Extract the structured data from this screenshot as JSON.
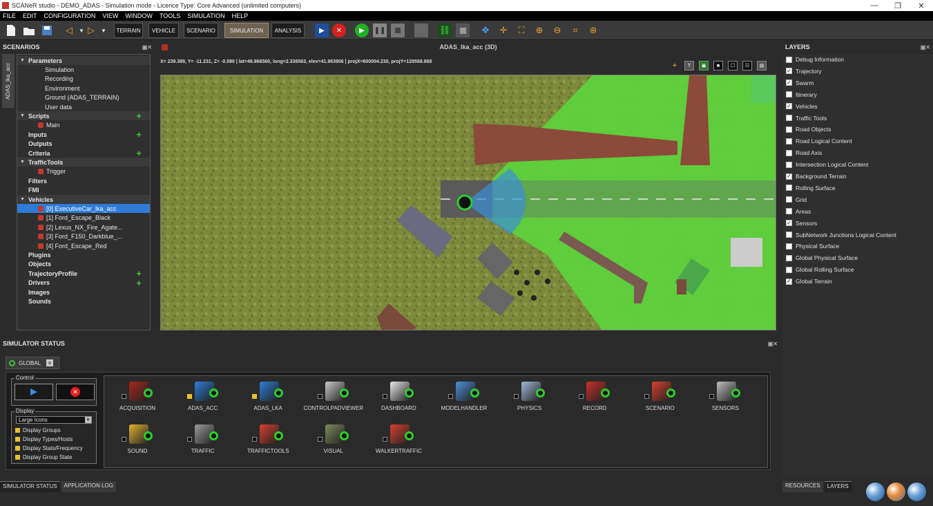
{
  "window": {
    "title": "SCANeR studio - DEMO_ADAS - Simulation mode - Licence Type: Core Advanced (unlimited computers)",
    "controls": [
      "—",
      "❐",
      "✕"
    ]
  },
  "menu": [
    "FILE",
    "EDIT",
    "CONFIGURATION",
    "VIEW",
    "WINDOW",
    "TOOLS",
    "SIMULATION",
    "HELP"
  ],
  "toolbar": {
    "modes": [
      "TERRAIN",
      "VEHICLE",
      "SCENARIO",
      "SIMULATION",
      "ANALYSIS"
    ],
    "active_mode": "SIMULATION"
  },
  "scenarios": {
    "title": "SCENARIOS",
    "vtab": "ADAS_lka_acc",
    "tree": [
      {
        "label": "Parameters",
        "kind": "cat",
        "open": true
      },
      {
        "label": "Simulation",
        "kind": "leaf"
      },
      {
        "label": "Recording",
        "kind": "leaf"
      },
      {
        "label": "Environment",
        "kind": "leaf"
      },
      {
        "label": "Ground (ADAS_TERRAIN)",
        "kind": "leaf"
      },
      {
        "label": "User data",
        "kind": "leaf"
      },
      {
        "label": "Scripts",
        "kind": "cat",
        "open": true,
        "plus": true
      },
      {
        "label": "Main",
        "kind": "leaf2"
      },
      {
        "label": "Inputs",
        "kind": "cat2",
        "plus": true
      },
      {
        "label": "Outputs",
        "kind": "cat2"
      },
      {
        "label": "Criteria",
        "kind": "cat2",
        "plus": true
      },
      {
        "label": "TrafficTools",
        "kind": "cat",
        "open": true
      },
      {
        "label": "Trigger",
        "kind": "leaf2"
      },
      {
        "label": "Filters",
        "kind": "cat2"
      },
      {
        "label": "FMI",
        "kind": "cat2"
      },
      {
        "label": "Vehicles",
        "kind": "cat",
        "open": true
      },
      {
        "label": "[0] ExecutiveCar_lka_acc",
        "kind": "sel"
      },
      {
        "label": "[1] Ford_Escape_Black",
        "kind": "leaf2"
      },
      {
        "label": "[2] Lexus_NX_Fire_Agate...",
        "kind": "leaf2"
      },
      {
        "label": "[3] Ford_F150_Darkblue_...",
        "kind": "leaf2"
      },
      {
        "label": "[4] Ford_Escape_Red",
        "kind": "leaf2"
      },
      {
        "label": "Plugins",
        "kind": "cat2"
      },
      {
        "label": "Objects",
        "kind": "cat2"
      },
      {
        "label": "TrajectoryProfile",
        "kind": "cat2",
        "plus": true
      },
      {
        "label": "Drivers",
        "kind": "cat2",
        "plus": true
      },
      {
        "label": "Images",
        "kind": "cat2"
      },
      {
        "label": "Sounds",
        "kind": "cat2"
      }
    ]
  },
  "viewport": {
    "title": "ADAS_lka_acc (3D)",
    "coords": "X= 239.389, Y= -11.231, Z= -0.090 | lat=48.866560, long=2.336563, elev=41.963906 | projX=600004.230, projY=129568.868",
    "icons": [
      "⌖",
      "T",
      "▣",
      "■",
      "☐",
      "☷",
      "▤"
    ]
  },
  "layers": {
    "title": "LAYERS",
    "items": [
      {
        "label": "Debug Information",
        "checked": false
      },
      {
        "label": "Trajectory",
        "checked": true
      },
      {
        "label": "Swarm",
        "checked": true
      },
      {
        "label": "Itinerary",
        "checked": false
      },
      {
        "label": "Vehicles",
        "checked": true
      },
      {
        "label": "Traffic Tools",
        "checked": false
      },
      {
        "label": "Road Objects",
        "checked": false
      },
      {
        "label": "Road Logical Content",
        "checked": false
      },
      {
        "label": "Road Axis",
        "checked": false
      },
      {
        "label": "Intersection Logical Content",
        "checked": false
      },
      {
        "label": "Background Terrain",
        "checked": true
      },
      {
        "label": "Rolling Surface",
        "checked": false
      },
      {
        "label": "Grid",
        "checked": false
      },
      {
        "label": "Areas",
        "checked": false
      },
      {
        "label": "Sensors",
        "checked": true
      },
      {
        "label": "SubNetwork Junctions Logical Content",
        "checked": false
      },
      {
        "label": "Physical Surface",
        "checked": false
      },
      {
        "label": "Global Physical Surface",
        "checked": false
      },
      {
        "label": "Global Rolling Surface",
        "checked": false
      },
      {
        "label": "Global Terrain",
        "checked": true
      }
    ]
  },
  "sim": {
    "title": "SIMULATOR STATUS",
    "tab": "GLOBAL",
    "control_label": "Control",
    "display_label": "Display",
    "display_select": "Large Icons",
    "display_options": [
      "Display Groups",
      "Display Types/Hosts",
      "Display Stats/Frequency",
      "Display Group State"
    ],
    "modules": [
      {
        "label": "ACQUISITION",
        "checked": false,
        "color": "#a8261c"
      },
      {
        "label": "ADAS_ACC",
        "checked": true,
        "color": "#2f7cd6"
      },
      {
        "label": "ADAS_LKA",
        "checked": true,
        "color": "#2f7cd6"
      },
      {
        "label": "CONTROLPADVIEWER",
        "checked": false,
        "color": "#c9c9c9"
      },
      {
        "label": "DASHBOARD",
        "checked": false,
        "color": "#e8e8e8"
      },
      {
        "label": "MODELHANDLER",
        "checked": false,
        "color": "#4d8fd6"
      },
      {
        "label": "PHYSICS",
        "checked": false,
        "color": "#9fb9d8"
      },
      {
        "label": "RECORD",
        "checked": false,
        "color": "#c8302b"
      },
      {
        "label": "SCENARIO",
        "checked": false,
        "color": "#d6402e"
      },
      {
        "label": "SENSORS",
        "checked": false,
        "color": "#bdbdbd"
      },
      {
        "label": "SOUND",
        "checked": false,
        "color": "#e0b030"
      },
      {
        "label": "TRAFFIC",
        "checked": false,
        "color": "#999999"
      },
      {
        "label": "TRAFFICTOOLS",
        "checked": false,
        "color": "#d6402e"
      },
      {
        "label": "VISUAL",
        "checked": false,
        "color": "#7c8b5c"
      },
      {
        "label": "WALKERTRAFFIC",
        "checked": false,
        "color": "#d6402e"
      }
    ]
  },
  "bottom_tabs_left": [
    "SIMULATOR STATUS",
    "APPLICATION LOG"
  ],
  "bottom_tabs_right": [
    "RESOURCES",
    "LAYERS"
  ],
  "colors": {
    "accent": "#2f7cd6",
    "status_green": "#2ad02a",
    "check_yellow": "#e8c030",
    "grass": "#7b8a3a",
    "highlight": "#5cd43c"
  }
}
